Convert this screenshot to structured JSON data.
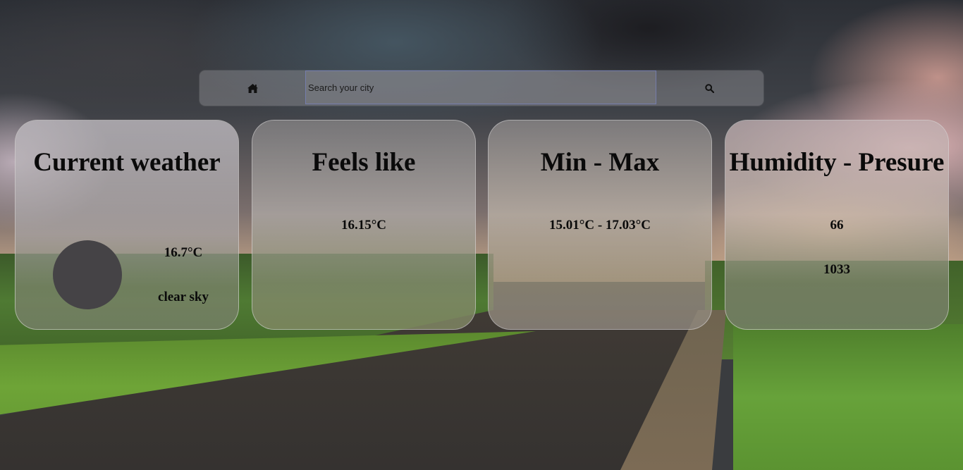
{
  "search": {
    "placeholder": "Search your city",
    "home_icon": "home-icon",
    "search_icon": "magnifier-icon"
  },
  "cards": {
    "current": {
      "title": "Current weather",
      "temperature": "16.7°C",
      "description": "clear sky",
      "icon": "weather-condition-icon"
    },
    "feels_like": {
      "title": "Feels like",
      "value": "16.15°C"
    },
    "min_max": {
      "title": "Min - Max",
      "value": "15.01°C - 17.03°C"
    },
    "humidity_pressure": {
      "title": "Humidity - Presure",
      "humidity": "66",
      "pressure": "1033"
    }
  },
  "colors": {
    "card_fill": "#afaaaa",
    "text": "#0a0a0a",
    "input_border": "#7882c8"
  }
}
